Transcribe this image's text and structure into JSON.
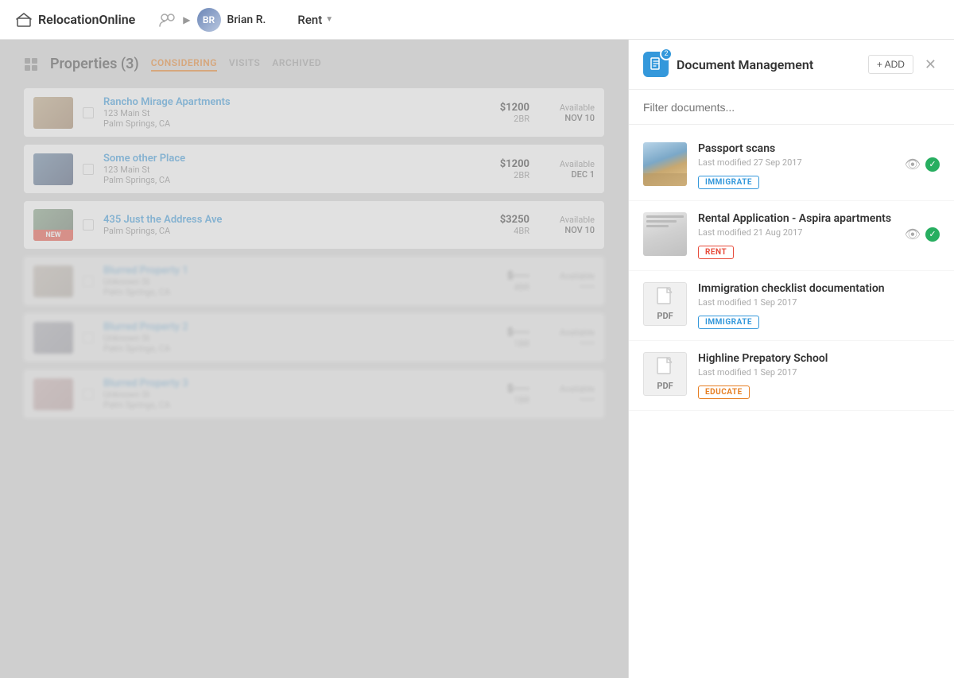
{
  "topnav": {
    "logo_text": "RelocationOnline",
    "user_name": "Brian R.",
    "rent_label": "Rent",
    "avatar_initials": "BR"
  },
  "properties_panel": {
    "title": "Properties (3)",
    "tabs": [
      {
        "label": "CONSIDERING",
        "active": true
      },
      {
        "label": "VISITS",
        "active": false
      },
      {
        "label": "ARCHIVED",
        "active": false
      }
    ],
    "items": [
      {
        "name": "Rancho Mirage Apartments",
        "address1": "123 Main St",
        "address2": "Palm Springs, CA",
        "price": "$1200",
        "bedrooms": "2BR",
        "availability": "Available",
        "avail_date": "NOV 10",
        "is_new": false,
        "blurred": false,
        "thumb_class": "thumb-1"
      },
      {
        "name": "Some other Place",
        "address1": "123 Main St",
        "address2": "Palm Springs, CA",
        "price": "$1200",
        "bedrooms": "2BR",
        "availability": "Available",
        "avail_date": "DEC 1",
        "is_new": false,
        "blurred": false,
        "thumb_class": "thumb-2"
      },
      {
        "name": "435 Just the Address Ave",
        "address1": "Palm Springs, CA",
        "address2": "",
        "price": "$3250",
        "bedrooms": "4BR",
        "availability": "Available",
        "avail_date": "NOV 10",
        "is_new": true,
        "blurred": false,
        "thumb_class": "thumb-3"
      },
      {
        "name": "Blurred Property 1",
        "address1": "Unknown St",
        "address2": "Palm Springs, CA",
        "price": "$----",
        "bedrooms": "4BR",
        "availability": "Available",
        "avail_date": "-----",
        "is_new": false,
        "blurred": true,
        "thumb_class": "thumb-4"
      },
      {
        "name": "Blurred Property 2",
        "address1": "Unknown St",
        "address2": "Palm Springs, CA",
        "price": "$----",
        "bedrooms": "1BR",
        "availability": "Available",
        "avail_date": "-----",
        "is_new": false,
        "blurred": true,
        "thumb_class": "thumb-5"
      },
      {
        "name": "Blurred Property 3",
        "address1": "Unknown St",
        "address2": "Palm Springs, CA",
        "price": "$----",
        "bedrooms": "1BR",
        "availability": "Available",
        "avail_date": "-----",
        "is_new": false,
        "blurred": true,
        "thumb_class": "thumb-6"
      }
    ]
  },
  "document_panel": {
    "title": "Document Management",
    "badge_count": "2",
    "add_button_label": "+ ADD",
    "filter_placeholder": "Filter documents...",
    "documents": [
      {
        "id": "passport",
        "name": "Passport scans",
        "modified": "Last modified 27 Sep 2017",
        "tag": "IMMIGRATE",
        "tag_class": "tag-immigrate",
        "has_actions": true,
        "thumb_type": "passport"
      },
      {
        "id": "rental",
        "name": "Rental Application - Aspira apartments",
        "modified": "Last modified 21 Aug 2017",
        "tag": "RENT",
        "tag_class": "tag-rent",
        "has_actions": true,
        "thumb_type": "rental"
      },
      {
        "id": "immigration-checklist",
        "name": "Immigration checklist documentation",
        "modified": "Last modified 1 Sep 2017",
        "tag": "IMMIGRATE",
        "tag_class": "tag-immigrate",
        "has_actions": false,
        "thumb_type": "pdf"
      },
      {
        "id": "highline",
        "name": "Highline Prepatory School",
        "modified": "Last modified 1 Sep 2017",
        "tag": "EDUCATE",
        "tag_class": "tag-educate",
        "has_actions": false,
        "thumb_type": "pdf"
      }
    ]
  }
}
